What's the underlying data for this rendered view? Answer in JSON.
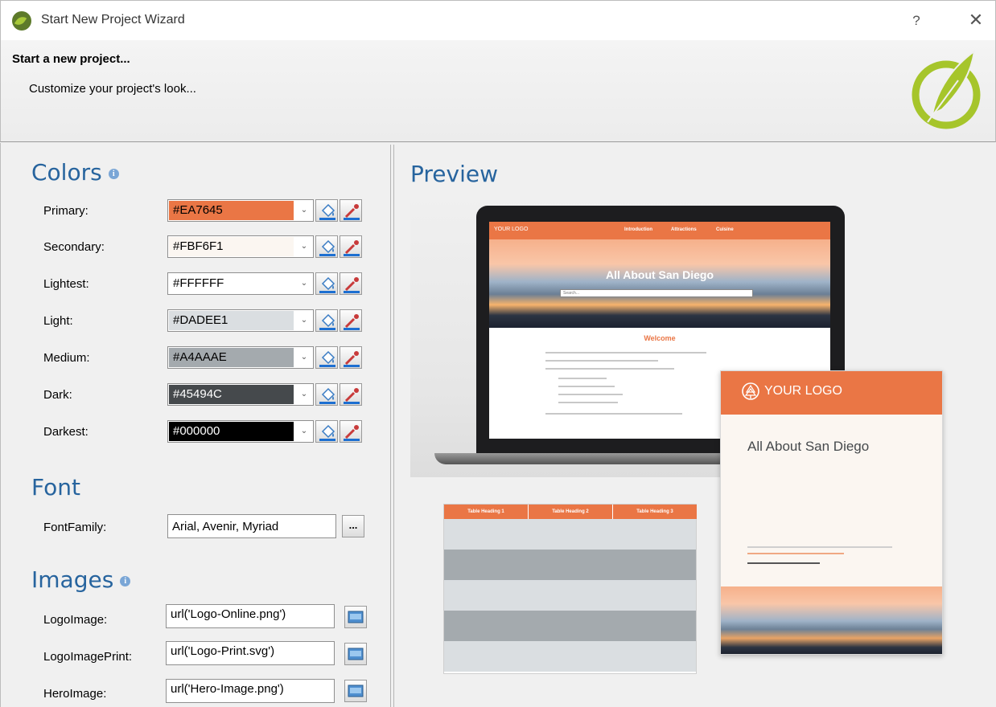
{
  "window": {
    "title": "Start New Project Wizard",
    "help_label": "?",
    "close_label": "✕"
  },
  "header": {
    "title": "Start a new project...",
    "subtitle": "Customize your project's look..."
  },
  "sections": {
    "colors": "Colors",
    "font": "Font",
    "images": "Images",
    "preview": "Preview"
  },
  "colors": [
    {
      "label": "Primary:",
      "value": "#EA7645",
      "swatch": "#EA7645",
      "text_color": "#000000"
    },
    {
      "label": "Secondary:",
      "value": "#FBF6F1",
      "swatch": "#FBF6F1",
      "text_color": "#000000"
    },
    {
      "label": "Lightest:",
      "value": "#FFFFFF",
      "swatch": "#FFFFFF",
      "text_color": "#000000"
    },
    {
      "label": "Light:",
      "value": "#DADEE1",
      "swatch": "#DADEE1",
      "text_color": "#000000"
    },
    {
      "label": "Medium:",
      "value": "#A4AAAE",
      "swatch": "#A4AAAE",
      "text_color": "#000000"
    },
    {
      "label": "Dark:",
      "value": "#45494C",
      "swatch": "#45494C",
      "text_color": "#FFFFFF"
    },
    {
      "label": "Darkest:",
      "value": "#000000",
      "swatch": "#000000",
      "text_color": "#FFFFFF"
    }
  ],
  "font": {
    "label": "FontFamily:",
    "value": "Arial, Avenir, Myriad",
    "button": "..."
  },
  "images": [
    {
      "label": "LogoImage:",
      "value": "url('Logo-Online.png')"
    },
    {
      "label": "LogoImagePrint:",
      "value": "url('Logo-Print.svg')"
    },
    {
      "label": "HeroImage:",
      "value": "url('Hero-Image.png')"
    }
  ],
  "preview": {
    "online": {
      "logo": "YOUR LOGO",
      "nav_links": [
        "Introduction",
        "Attractions",
        "Cuisine"
      ],
      "hero_title": "All About San Diego",
      "search_placeholder": "Search...",
      "welcome": "Welcome"
    },
    "print": {
      "logo": "YOUR LOGO",
      "title": "All About San Diego"
    },
    "table": {
      "headings": [
        "Table Heading 1",
        "Table Heading 2",
        "Table Heading 3"
      ]
    }
  },
  "accent_colors": {
    "title_blue": "#27649E",
    "primary": "#EA7645"
  }
}
